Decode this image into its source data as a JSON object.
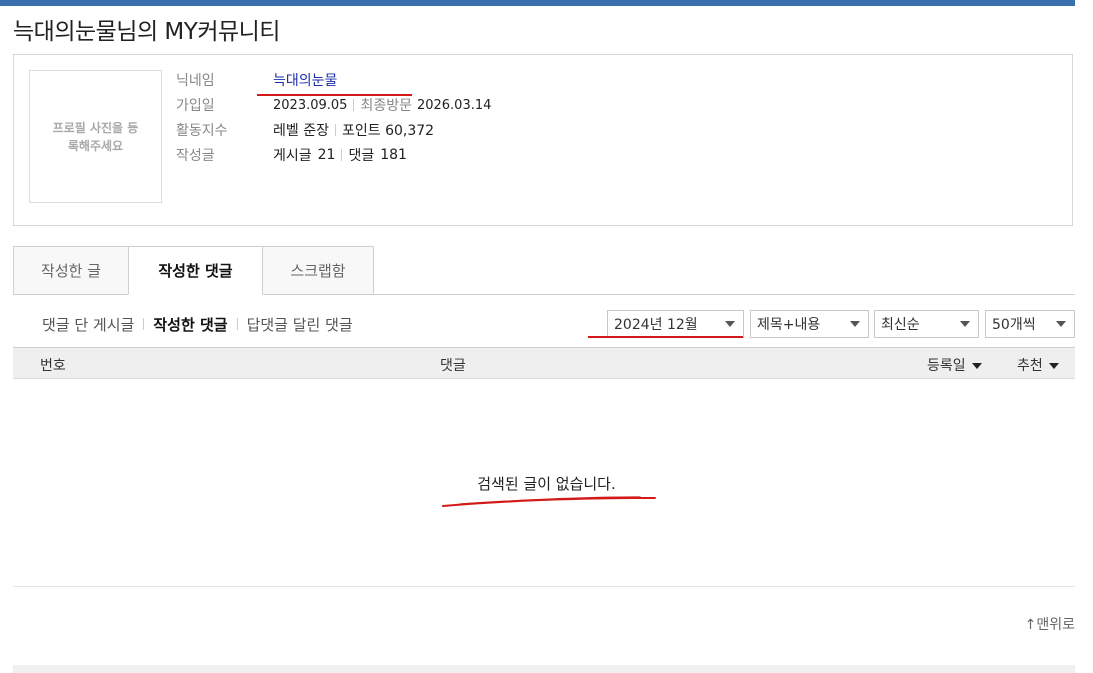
{
  "page_title": "늑대의눈물님의 MY커뮤니티",
  "profile": {
    "photo_placeholder": "프로필 사진을 등록해주세요",
    "nickname_label": "닉네임",
    "nickname": "늑대의눈물",
    "join_label": "가입일",
    "join_date": "2023.09.05",
    "last_visit_label": "최종방문",
    "last_visit": "2026.03.14",
    "activity_label": "활동지수",
    "level": "레벨 준장",
    "points": "포인트 60,372",
    "posts_label": "작성글",
    "post_label": "게시글",
    "post_count": "21",
    "comment_label": "댓글",
    "comment_count": "181"
  },
  "tabs": [
    {
      "label": "작성한 글",
      "active": false
    },
    {
      "label": "작성한 댓글",
      "active": true
    },
    {
      "label": "스크랩함",
      "active": false
    }
  ],
  "subnav": [
    "댓글 단 게시글",
    "작성한 댓글",
    "답댓글 달린 댓글"
  ],
  "filters": {
    "month": "2024년 12월",
    "search_scope": "제목+내용",
    "sort": "최신순",
    "page_size": "50개씩"
  },
  "table": {
    "col_number": "번호",
    "col_comment": "댓글",
    "col_date": "등록일",
    "col_recommend": "추천"
  },
  "empty_message": "검색된 글이 없습니다.",
  "to_top": "↑맨위로",
  "colors": {
    "accent_bar": "#3a6fb0",
    "link_blue": "#1b2ea8",
    "annotation_red": "#d21a1a"
  }
}
